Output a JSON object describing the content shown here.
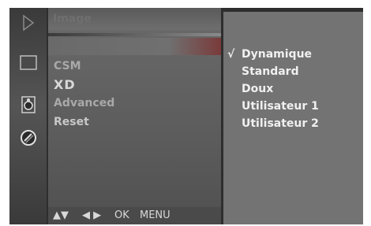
{
  "sidebar": {
    "icons": [
      "picture-icon",
      "screen-icon",
      "audio-icon",
      "time-icon"
    ]
  },
  "menu": {
    "title": "Image",
    "items": [
      {
        "label": "CSM"
      },
      {
        "label": "XD"
      },
      {
        "label": "Advanced"
      },
      {
        "label": "Reset"
      }
    ],
    "footer": {
      "updown": "▲▼",
      "leftright": "◀ ▶",
      "ok": "OK",
      "menu": "MENU"
    }
  },
  "options": {
    "checkmark": "√",
    "items": [
      {
        "label": "Dynamique",
        "selected": true
      },
      {
        "label": "Standard"
      },
      {
        "label": "Doux"
      },
      {
        "label": "Utilisateur 1"
      },
      {
        "label": "Utilisateur 2"
      }
    ]
  }
}
